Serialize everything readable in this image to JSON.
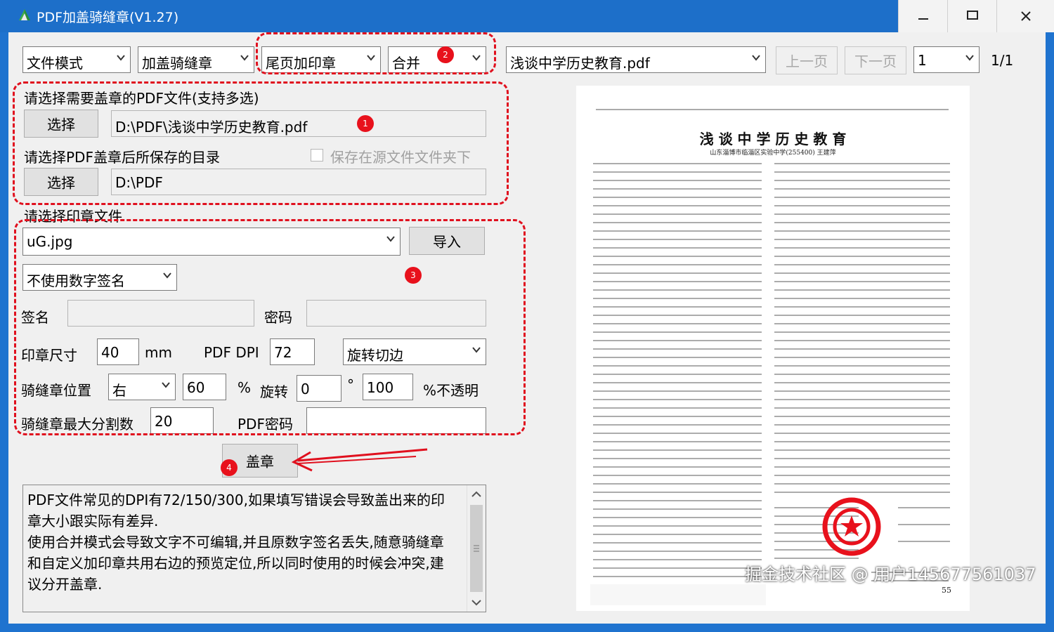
{
  "window": {
    "title": "PDF加盖骑缝章(V1.27)",
    "minimize_icon": "minimize-icon",
    "maximize_icon": "maximize-icon",
    "close_icon": "close-icon"
  },
  "toolbar": {
    "mode_select": "文件模式",
    "action_select": "加盖骑缝章",
    "stamp_position_select": "尾页加印章",
    "merge_select": "合并",
    "file_select": "浅谈中学历史教育.pdf",
    "prev_page": "上一页",
    "next_page": "下一页",
    "page_select": "1",
    "page_count": "1/1"
  },
  "source": {
    "label": "请选择需要盖章的PDF文件(支持多选)",
    "choose_button": "选择",
    "path": "D:\\PDF\\浅谈中学历史教育.pdf"
  },
  "output": {
    "label": "请选择PDF盖章后所保存的目录",
    "save_in_source_label": "保存在源文件文件夹下",
    "choose_button": "选择",
    "path": "D:\\PDF"
  },
  "stamp": {
    "label": "请选择印章文件",
    "file_select": "uG.jpg",
    "import_button": "导入",
    "signature_select": "不使用数字签名",
    "signature_label": "签名",
    "signature_value": "",
    "password_label": "密码",
    "password_value": "",
    "size_label": "印章尺寸",
    "size_value": "40",
    "size_unit": "mm",
    "dpi_label": "PDF DPI",
    "dpi_value": "72",
    "rotate_select": "旋转切边",
    "seam_position_label": "骑缝章位置",
    "seam_position_select": "右",
    "seam_percent_value": "60",
    "seam_percent_unit": "%",
    "rotation_label": "旋转",
    "rotation_value": "0",
    "rotation_unit": "°",
    "opacity_value": "100",
    "opacity_unit": "%不透明",
    "max_split_label": "骑缝章最大分割数",
    "max_split_value": "20",
    "pdf_password_label": "PDF密码",
    "pdf_password_value": ""
  },
  "action": {
    "stamp_button": "盖章"
  },
  "log": {
    "lines": [
      "PDF文件常见的DPI有72/150/300,如果填写错误会导致盖出来的印",
      "章大小跟实际有差异.",
      "使用合并模式会导致文字不可编辑,并且原数字签名丢失,随意骑缝章",
      "和自定义加印章共用右边的预览定位,所以同时使用的时候会冲突,建",
      "议分开盖章."
    ]
  },
  "annotations": {
    "badge_1": "1",
    "badge_2": "2",
    "badge_3": "3",
    "badge_4": "4"
  },
  "preview": {
    "title": "浅 谈 中 学 历 史 教 育",
    "author": "山东淄博市临淄区实验中学(255400) 王建萍",
    "page_number": "55"
  },
  "watermark": "掘金技术社区 @ 用户145677561037",
  "colors": {
    "titlebar": "#1d6fc9",
    "annotation_red": "#e0101e",
    "seal_red": "#e8111c"
  }
}
